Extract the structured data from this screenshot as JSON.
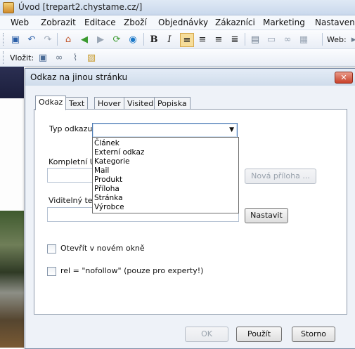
{
  "window": {
    "title": "Úvod  [trepart2.chystame.cz/]"
  },
  "menu": [
    "Web",
    "Zobrazit",
    "Editace",
    "Zboží",
    "Objednávky",
    "Zákazníci",
    "Marketing",
    "Nastavení"
  ],
  "toolbar": {
    "web_label": "Web:",
    "insert_label": "Vložit:"
  },
  "dialog": {
    "title": "Odkaz na jinou stránku",
    "close_glyph": "✕",
    "tabs": [
      "Odkaz",
      "Text",
      "Hover",
      "Visited",
      "Popiska"
    ],
    "active_tab": "Odkaz",
    "link_type_label": "Typ odkazu:",
    "link_type_value": "",
    "options": [
      "Článek",
      "Externí odkaz",
      "Kategorie",
      "Mail",
      "Produkt",
      "Příloha",
      "Stránka",
      "Výrobce"
    ],
    "full_url_label": "Kompletní URL:",
    "full_url_visible": "Kompletní Ul",
    "visible_text_label": "Viditelný text:",
    "visible_text_visible": "Viditelný text:",
    "new_attachment_button": "Nová příloha ...",
    "set_button": "Nastavit",
    "open_new_window_label": "Otevřít v novém okně",
    "nofollow_label": "rel = \"nofollow\" (pouze pro experty!)",
    "ok_button": "OK",
    "apply_button": "Použít",
    "cancel_button": "Storno"
  },
  "colors": {
    "accent": "#4f7bb3",
    "close": "#c8412a",
    "dialog_bg": "#eef2f8"
  }
}
